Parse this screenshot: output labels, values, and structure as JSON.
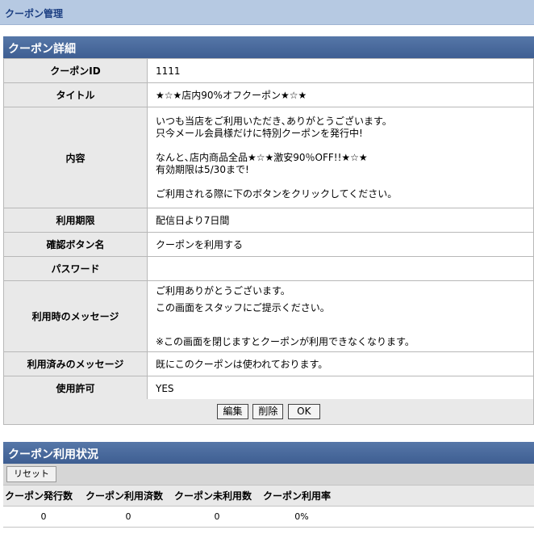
{
  "header": {
    "title": "クーポン管理"
  },
  "detail": {
    "section_title": "クーポン詳細",
    "rows": {
      "coupon_id": {
        "label": "クーポンID",
        "value": "1111"
      },
      "title": {
        "label": "タイトル",
        "value": "★☆★店内90%オフクーポン★☆★"
      },
      "content": {
        "label": "内容",
        "lines": [
          "いつも当店をご利用いただき､ありがとうございます。",
          "只今メール会員様だけに特別クーポンを発行中!",
          "",
          "なんと､店内商品全品★☆★激安90％OFF!!★☆★",
          "有効期限は5/30まで!",
          "",
          "ご利用される際に下のボタンをクリックしてください。"
        ]
      },
      "period": {
        "label": "利用期限",
        "value": "配信日より7日間"
      },
      "button_name": {
        "label": "確認ボタン名",
        "value": "クーポンを利用する"
      },
      "password": {
        "label": "パスワード",
        "value": ""
      },
      "use_message": {
        "label": "利用時のメッセージ",
        "lines": [
          "ご利用ありがとうございます。",
          "この画面をスタッフにご提示ください。",
          "",
          "※この画面を閉じますとクーポンが利用できなくなります。"
        ]
      },
      "used_message": {
        "label": "利用済みのメッセージ",
        "value": "既にこのクーポンは使われております。"
      },
      "permission": {
        "label": "使用許可",
        "value": "YES"
      }
    },
    "buttons": {
      "edit": "編集",
      "delete": "削除",
      "ok": "OK"
    }
  },
  "usage": {
    "section_title": "クーポン利用状況",
    "reset_label": "リセット",
    "headers": [
      "クーポン発行数",
      "クーポン利用済数",
      "クーポン未利用数",
      "クーポン利用率"
    ],
    "values": [
      "0",
      "0",
      "0",
      "0%"
    ]
  }
}
